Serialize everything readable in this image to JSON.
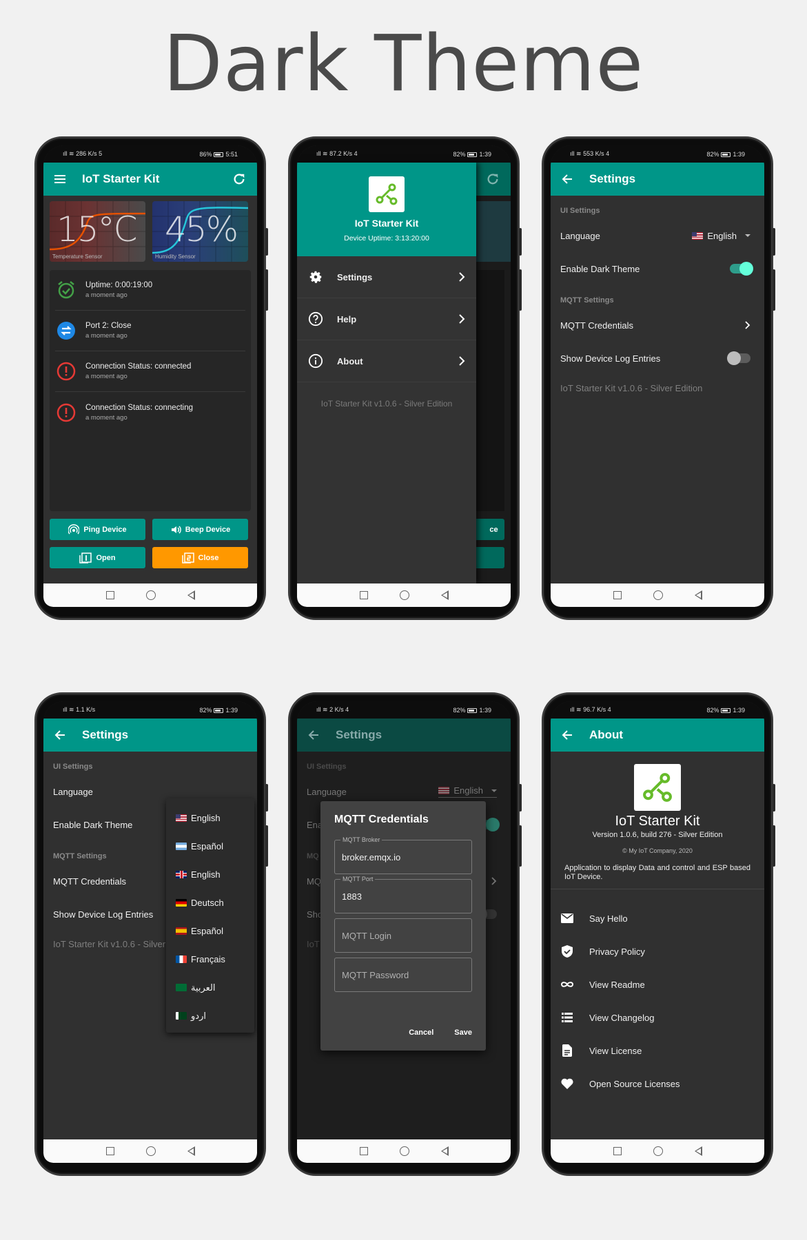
{
  "page_title": "Dark Theme",
  "colors": {
    "primary": "#009688",
    "accent": "#64ffda",
    "orange": "#ff9800",
    "dark_bg": "#303030"
  },
  "status": {
    "p1": {
      "net": "286 K/s",
      "badge": "5",
      "battery": "86%",
      "time": "5:51"
    },
    "p2": {
      "net": "87.2 K/s",
      "badge": "4",
      "battery": "82%",
      "time": "1:39"
    },
    "p3": {
      "net": "553 K/s",
      "badge": "4",
      "battery": "82%",
      "time": "1:39"
    },
    "p4": {
      "net": "1.1 K/s",
      "badge": "",
      "battery": "82%",
      "time": "1:39"
    },
    "p5": {
      "net": "2 K/s",
      "badge": "4",
      "battery": "82%",
      "time": "1:39"
    },
    "p6": {
      "net": "96.7 K/s",
      "badge": "4",
      "battery": "82%",
      "time": "1:39"
    }
  },
  "home": {
    "title": "IoT Starter Kit",
    "temperature": {
      "value": "15°C",
      "label": "Temperature Sensor"
    },
    "humidity": {
      "value": "45%",
      "label": "Humidity Sensor"
    },
    "events": [
      {
        "title": "Uptime: 0:00:19:00",
        "time": "a moment ago",
        "icon": "alarm-check-icon"
      },
      {
        "title": "Port 2: Close",
        "time": "a moment ago",
        "icon": "swap-icon"
      },
      {
        "title": "Connection Status: connected",
        "time": "a moment ago",
        "icon": "info-icon"
      },
      {
        "title": "Connection Status: connecting",
        "time": "a moment ago",
        "icon": "info-icon"
      }
    ],
    "buttons": {
      "ping": "Ping Device",
      "beep": "Beep Device",
      "open": "Open",
      "close": "Close"
    }
  },
  "drawer": {
    "app_name": "IoT Starter Kit",
    "uptime": "Device Uptime: 3:13:20:00",
    "items": [
      {
        "label": "Settings",
        "icon": "gear-icon"
      },
      {
        "label": "Help",
        "icon": "help-icon"
      },
      {
        "label": "About",
        "icon": "info-icon"
      }
    ],
    "version": "IoT Starter Kit v1.0.6 - Silver Edition",
    "peek_text": "ce"
  },
  "settings": {
    "title": "Settings",
    "ui_section": "UI Settings",
    "language_label": "Language",
    "language_value": "English",
    "dark_theme_label": "Enable Dark Theme",
    "dark_theme_on": true,
    "mqtt_section": "MQTT Settings",
    "mqtt_credentials_label": "MQTT Credentials",
    "device_log_label": "Show Device Log Entries",
    "device_log_on": false,
    "version": "IoT Starter Kit v1.0.6 - Silver Edition",
    "version_cut": "IoT Starter Kit v1.0.6 - Silver"
  },
  "language_menu": [
    "English",
    "Español",
    "English",
    "Deutsch",
    "Español",
    "Français",
    "العربية",
    "اردو"
  ],
  "dialog": {
    "title": "MQTT Credentials",
    "broker_label": "MQTT Broker",
    "broker_value": "broker.emqx.io",
    "port_label": "MQTT Port",
    "port_value": "1883",
    "login_placeholder": "MQTT Login",
    "password_placeholder": "MQTT Password",
    "cancel": "Cancel",
    "save": "Save",
    "bg_short_1": "Ena",
    "bg_short_2": "MQ",
    "bg_short_3": "MQ",
    "bg_short_4": "Sho",
    "bg_short_5": "IoT"
  },
  "about": {
    "title": "About",
    "app_name": "IoT Starter Kit",
    "version": "Version 1.0.6, build 276 - Silver Edition",
    "copyright": "© My IoT Company, 2020",
    "description": "Application to display Data and control and ESP based IoT Device.",
    "items": [
      {
        "label": "Say Hello",
        "icon": "mail-icon"
      },
      {
        "label": "Privacy Policy",
        "icon": "shield-icon"
      },
      {
        "label": "View Readme",
        "icon": "infinity-icon"
      },
      {
        "label": "View Changelog",
        "icon": "list-icon"
      },
      {
        "label": "View License",
        "icon": "document-icon"
      },
      {
        "label": "Open Source Licenses",
        "icon": "heart-icon"
      }
    ]
  }
}
